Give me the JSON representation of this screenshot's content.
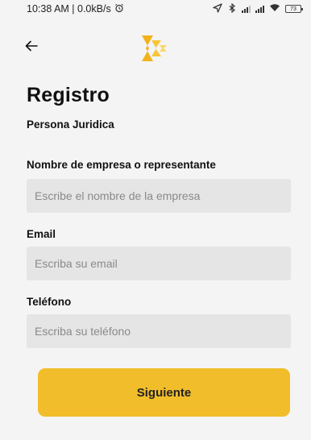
{
  "status_bar": {
    "time_speed": "10:38 AM | 0.0kB/s",
    "alarm_icon": "alarm-clock-icon",
    "battery_level": "73"
  },
  "header": {
    "back_icon": "arrow-left-icon",
    "logo_icon": "brand-logo-icon",
    "brand_color": "#f1bd2a"
  },
  "page": {
    "title": "Registro",
    "subtitle": "Persona Juridica"
  },
  "form": {
    "company": {
      "label": "Nombre de empresa o representante",
      "placeholder": "Escribe el nombre de la empresa",
      "value": ""
    },
    "email": {
      "label": "Email",
      "placeholder": "Escriba su email",
      "value": ""
    },
    "phone": {
      "label": "Teléfono",
      "placeholder": "Escriba su teléfono",
      "value": ""
    },
    "next_label": "Siguiente"
  },
  "colors": {
    "background": "#f4f4f4",
    "input_bg": "#e5e5e5",
    "accent": "#f1bd2a"
  }
}
